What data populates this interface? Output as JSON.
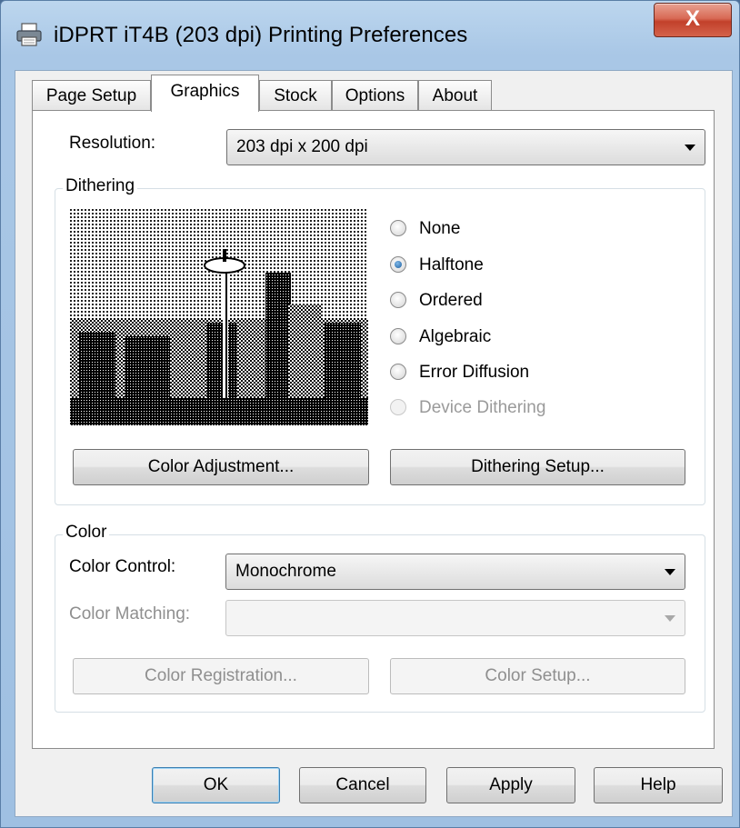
{
  "window": {
    "title": "iDPRT iT4B (203 dpi) Printing Preferences",
    "close_glyph": "X"
  },
  "tabs": [
    "Page Setup",
    "Graphics",
    "Stock",
    "Options",
    "About"
  ],
  "active_tab": "Graphics",
  "resolution": {
    "label": "Resolution:",
    "value": "203 dpi x 200 dpi"
  },
  "dithering": {
    "group_title": "Dithering",
    "options": [
      {
        "label": "None",
        "checked": false,
        "enabled": true
      },
      {
        "label": "Halftone",
        "checked": true,
        "enabled": true
      },
      {
        "label": "Ordered",
        "checked": false,
        "enabled": true
      },
      {
        "label": "Algebraic",
        "checked": false,
        "enabled": true
      },
      {
        "label": "Error Diffusion",
        "checked": false,
        "enabled": true
      },
      {
        "label": "Device Dithering",
        "checked": false,
        "enabled": false
      }
    ],
    "color_adjustment_button": "Color Adjustment...",
    "dithering_setup_button": "Dithering Setup..."
  },
  "color": {
    "group_title": "Color",
    "control_label": "Color Control:",
    "control_value": "Monochrome",
    "matching_label": "Color Matching:",
    "matching_value": "",
    "registration_button": "Color Registration...",
    "setup_button": "Color Setup..."
  },
  "footer": {
    "ok": "OK",
    "cancel": "Cancel",
    "apply": "Apply",
    "help": "Help"
  },
  "colors": {
    "titlebar": "#a9c7e6",
    "close_button": "#c2412b",
    "dialog_bg": "#f0f0f0",
    "panel_bg": "#ffffff"
  }
}
